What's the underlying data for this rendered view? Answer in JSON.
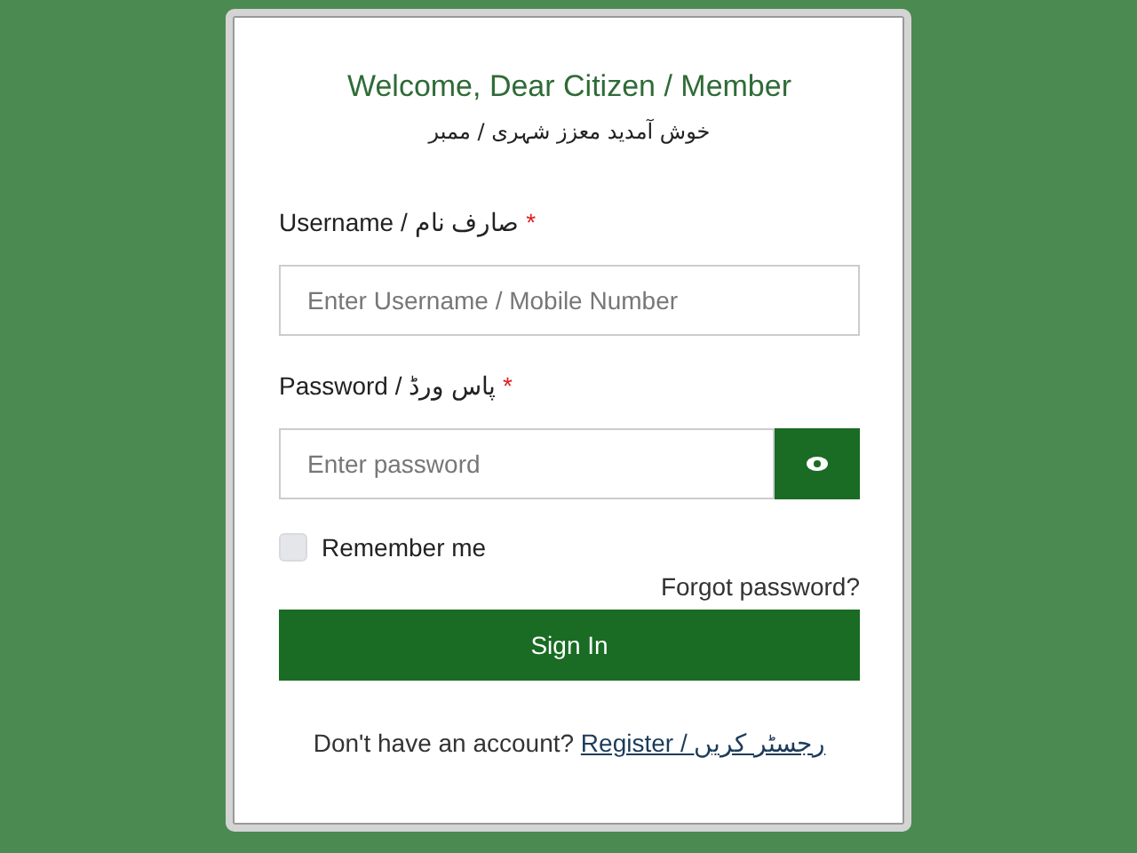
{
  "title": "Welcome, Dear Citizen / Member",
  "subtitle": "خوش آمدید معزز شہری / ممبر",
  "fields": [
    {
      "label": "Username / صارف نام",
      "required_mark": "*",
      "placeholder": "Enter Username / Mobile Number",
      "kind": "text"
    },
    {
      "label": "Password / پاس ورڈ",
      "required_mark": "*",
      "placeholder": "Enter password",
      "kind": "password"
    }
  ],
  "remember": {
    "label": "Remember me",
    "checked": false
  },
  "forgot_link": "Forgot password?",
  "sign_in_button": "Sign In",
  "register": {
    "text": "Don't have an account?",
    "link": "Register / رجسٹر کریں"
  }
}
